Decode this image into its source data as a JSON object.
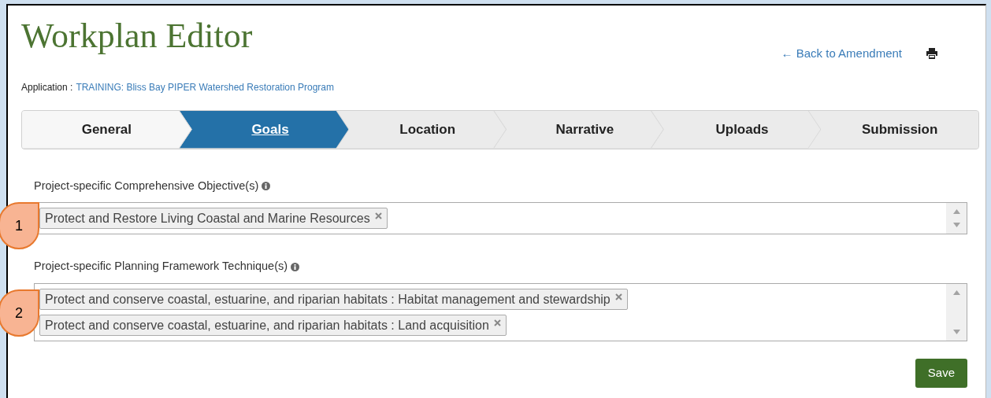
{
  "title": "Workplan Editor",
  "back_link": {
    "arrow": "←",
    "label": "Back to Amendment"
  },
  "application": {
    "label": "Application :",
    "value": "TRAINING: Bliss Bay PIPER Watershed Restoration Program"
  },
  "steps": [
    {
      "label": "General",
      "selected": false
    },
    {
      "label": "Goals",
      "selected": true
    },
    {
      "label": "Location",
      "selected": false
    },
    {
      "label": "Narrative",
      "selected": false
    },
    {
      "label": "Uploads",
      "selected": false
    },
    {
      "label": "Submission",
      "selected": false
    }
  ],
  "fields": [
    {
      "label": "Project-specific Comprehensive Objective(s)",
      "callout": "1",
      "tags": [
        "Protect and Restore Living Coastal and Marine Resources"
      ]
    },
    {
      "label": "Project-specific Planning Framework Technique(s)",
      "callout": "2",
      "tags": [
        "Protect and conserve coastal, estuarine, and riparian habitats : Habitat management and stewardship",
        "Protect and conserve coastal, estuarine, and riparian habitats : Land acquisition"
      ]
    }
  ],
  "save_button": "Save"
}
